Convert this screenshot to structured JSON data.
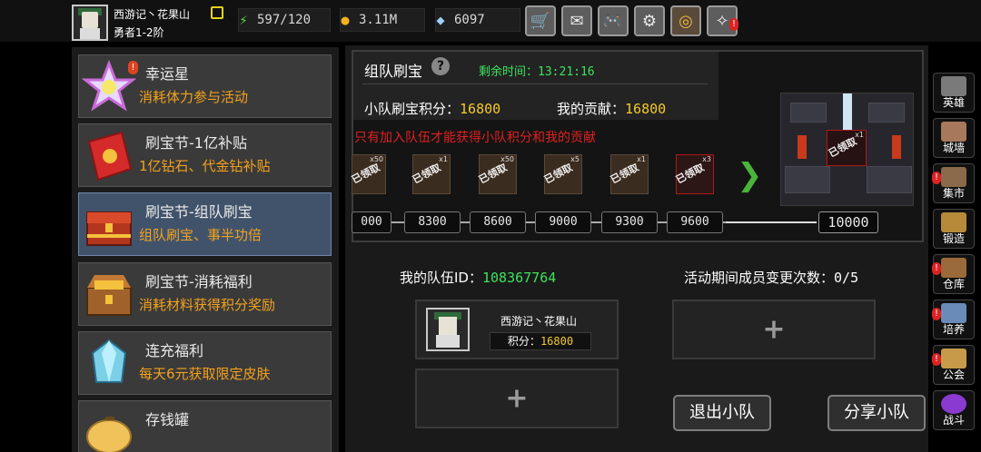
{
  "player": {
    "name": "西游记丶花果山",
    "rank": "勇者1-2阶"
  },
  "resources": {
    "energy": "597/120",
    "gold": "3.11M",
    "gems": "6097"
  },
  "top_icons": [
    "cart-icon",
    "mail-icon",
    "gamepad-icon",
    "gear-icon",
    "color-wheel-icon",
    "crack-alert-icon"
  ],
  "events": [
    {
      "title": "幸运星",
      "desc": "消耗体力参与活动",
      "badge": "!"
    },
    {
      "title": "刷宝节-1亿补贴",
      "desc": "1亿钻石、代金钻补贴"
    },
    {
      "title": "刷宝节-组队刷宝",
      "desc": "组队刷宝、事半功倍"
    },
    {
      "title": "刷宝节-消耗福利",
      "desc": "消耗材料获得积分奖励"
    },
    {
      "title": "连充福利",
      "desc": "每天6元获取限定皮肤"
    },
    {
      "title": "存钱罐",
      "desc": ""
    }
  ],
  "team_treasure": {
    "title": "组队刷宝",
    "timer_label": "剩余时间：",
    "timer_value": "13:21:16",
    "team_score_label": "小队刷宝积分：",
    "team_score": "16800",
    "my_contrib_label": "我的贡献：",
    "my_contrib": "16800",
    "warning": "只有加入队伍才能获得小队积分和我的贡献",
    "rewards": [
      {
        "count": "x50",
        "stamp": "已领取"
      },
      {
        "count": "x1",
        "stamp": "已领取"
      },
      {
        "count": "x50",
        "stamp": "已领取"
      },
      {
        "count": "x5",
        "stamp": "已领取"
      },
      {
        "count": "x1",
        "stamp": "已领取"
      },
      {
        "count": "x3",
        "stamp": "已领取"
      }
    ],
    "milestones": [
      "000",
      "8300",
      "8600",
      "9000",
      "9300",
      "9600"
    ],
    "final_milestone": "10000",
    "big_reward": {
      "count": "x1",
      "stamp": "已领取"
    }
  },
  "team": {
    "id_label": "我的队伍ID：",
    "id_value": "108367764",
    "change_label": "活动期间成员变更次数：",
    "change_value": "0/5",
    "member_name": "西游记丶花果山",
    "member_score_label": "积分：",
    "member_score": "16800",
    "empty_slot": "+",
    "leave_button": "退出小队",
    "share_button": "分享小队"
  },
  "right_nav": [
    {
      "label": "英雄",
      "icon": "helmet-icon",
      "color": "#7a7a7a",
      "alert": false
    },
    {
      "label": "城墙",
      "icon": "wall-icon",
      "color": "#a7785a",
      "alert": false
    },
    {
      "label": "集市",
      "icon": "market-icon",
      "color": "#8a6a4a",
      "alert": true
    },
    {
      "label": "锻造",
      "icon": "anvil-icon",
      "color": "#b78a3a",
      "alert": false
    },
    {
      "label": "仓库",
      "icon": "warehouse-icon",
      "color": "#9a6a3a",
      "alert": true
    },
    {
      "label": "培养",
      "icon": "flask-icon",
      "color": "#6a8ab7",
      "alert": true
    },
    {
      "label": "公会",
      "icon": "guild-icon",
      "color": "#c79a4a",
      "alert": true
    },
    {
      "label": "战斗",
      "icon": "portal-icon",
      "color": "#8a3ad0",
      "alert": false
    }
  ]
}
